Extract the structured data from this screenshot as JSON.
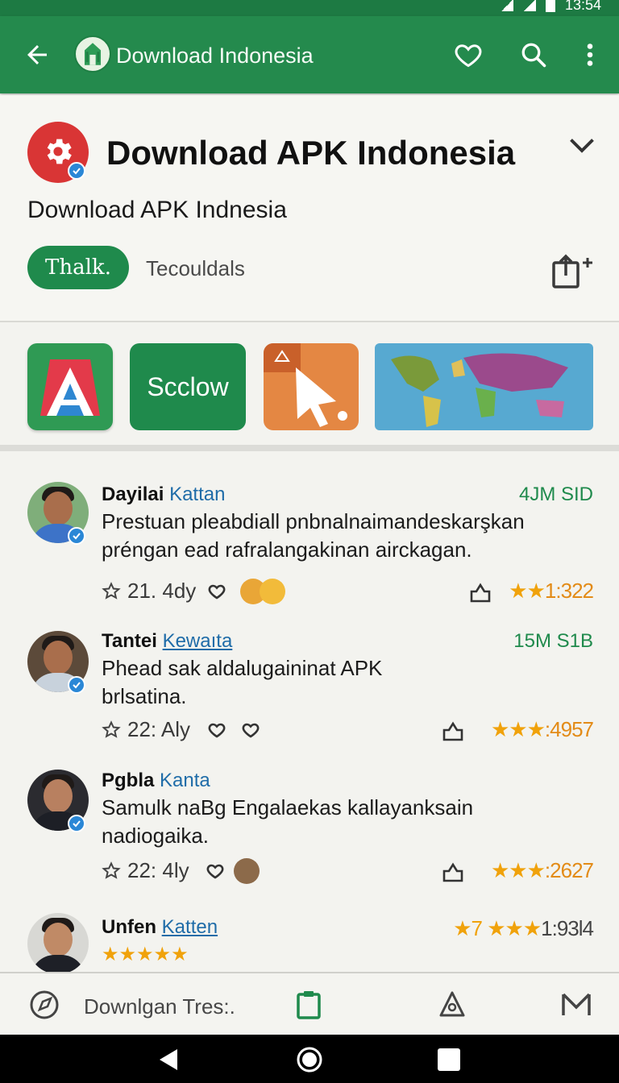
{
  "status_bar": {
    "time": "13:54"
  },
  "app_bar": {
    "title": "Download Indonesia",
    "icons": [
      "back-arrow-icon",
      "heart-icon",
      "search-icon",
      "more-vert-icon"
    ]
  },
  "header": {
    "app_name": "Download APK Indonesia",
    "subtitle": "Download APK Indnesia",
    "primary_button": "Thalk.",
    "secondary_link": "Tecouldals"
  },
  "screenshots": {
    "items": [
      {
        "label": ""
      },
      {
        "label": "Scclow"
      },
      {
        "label": ""
      },
      {
        "label": ""
      }
    ]
  },
  "reviews": [
    {
      "first_name": "Dayilai",
      "last_name": "Kattan",
      "meta": "4JM SID",
      "text": "Prestuan pleabdiall pnbnalnaimandeskarşkan préngan ead rafralangakinan airckagan.",
      "date": "21. 4dy",
      "rating_stars": "★★",
      "rating_value": "1:322"
    },
    {
      "first_name": "Tantei",
      "last_name": "Kewaıta",
      "meta": "15M S1B",
      "text": "Phead sak aldalugaininat APK brlsatina.",
      "date": "22: Aly",
      "rating_stars": "★★★",
      "rating_value": ":4957"
    },
    {
      "first_name": "Pgbla",
      "last_name": "Kanta",
      "meta": "",
      "text": "Samulk naBg Engalaekas kallayanksain nadiogaika.",
      "date": "22: 4ly",
      "rating_stars": "★★★",
      "rating_value": ":2627"
    },
    {
      "first_name": "Unfen",
      "last_name": "Katten",
      "meta": "",
      "text": "★★★★★",
      "date": "",
      "rating_stars": "★7 ★★★",
      "rating_value": "1:93l4"
    }
  ],
  "bottom_bar": {
    "label": "Downlgan Tres:."
  },
  "colors": {
    "primary_green": "#248a4d",
    "accent_blue": "#2a87d6",
    "star_orange": "#f0a20b"
  }
}
